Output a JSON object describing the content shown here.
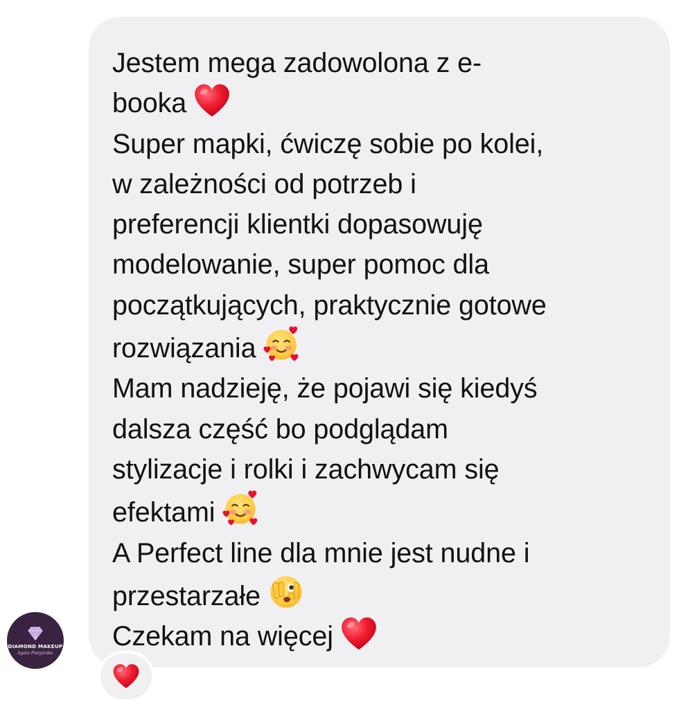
{
  "message": {
    "lines": [
      "Jestem mega zadowolona z e-",
      "booka",
      "Super mapki, ćwiczę sobie po kolei,",
      "w zależności od potrzeb i",
      "preferencji klientki dopasowuję",
      "modelowanie, super pomoc dla",
      "początkujących, praktycznie gotowe",
      "rozwiązania",
      "Mam nadzieję, że pojawi się kiedyś",
      "dalsza część bo podglądam",
      "stylizacje i rolki i zachwycam się",
      "efektami",
      "A Perfect line dla mnie jest nudne i",
      "przestarzałe",
      "Czekam na więcej"
    ],
    "emoji_names": {
      "heart": "red-heart-icon",
      "hearts_face": "smiling-face-with-hearts-icon",
      "peeking": "face-with-peeking-eye-icon"
    }
  },
  "avatar": {
    "brand": "DIAMOND MAKEUP",
    "signature": "Agata Podgórska"
  },
  "reaction": {
    "emoji": "red-heart-icon"
  },
  "colors": {
    "bubble_bg": "#f0f0f2",
    "text": "#111111",
    "heart": "#e8112d",
    "avatar_bg": "#3a2340"
  }
}
